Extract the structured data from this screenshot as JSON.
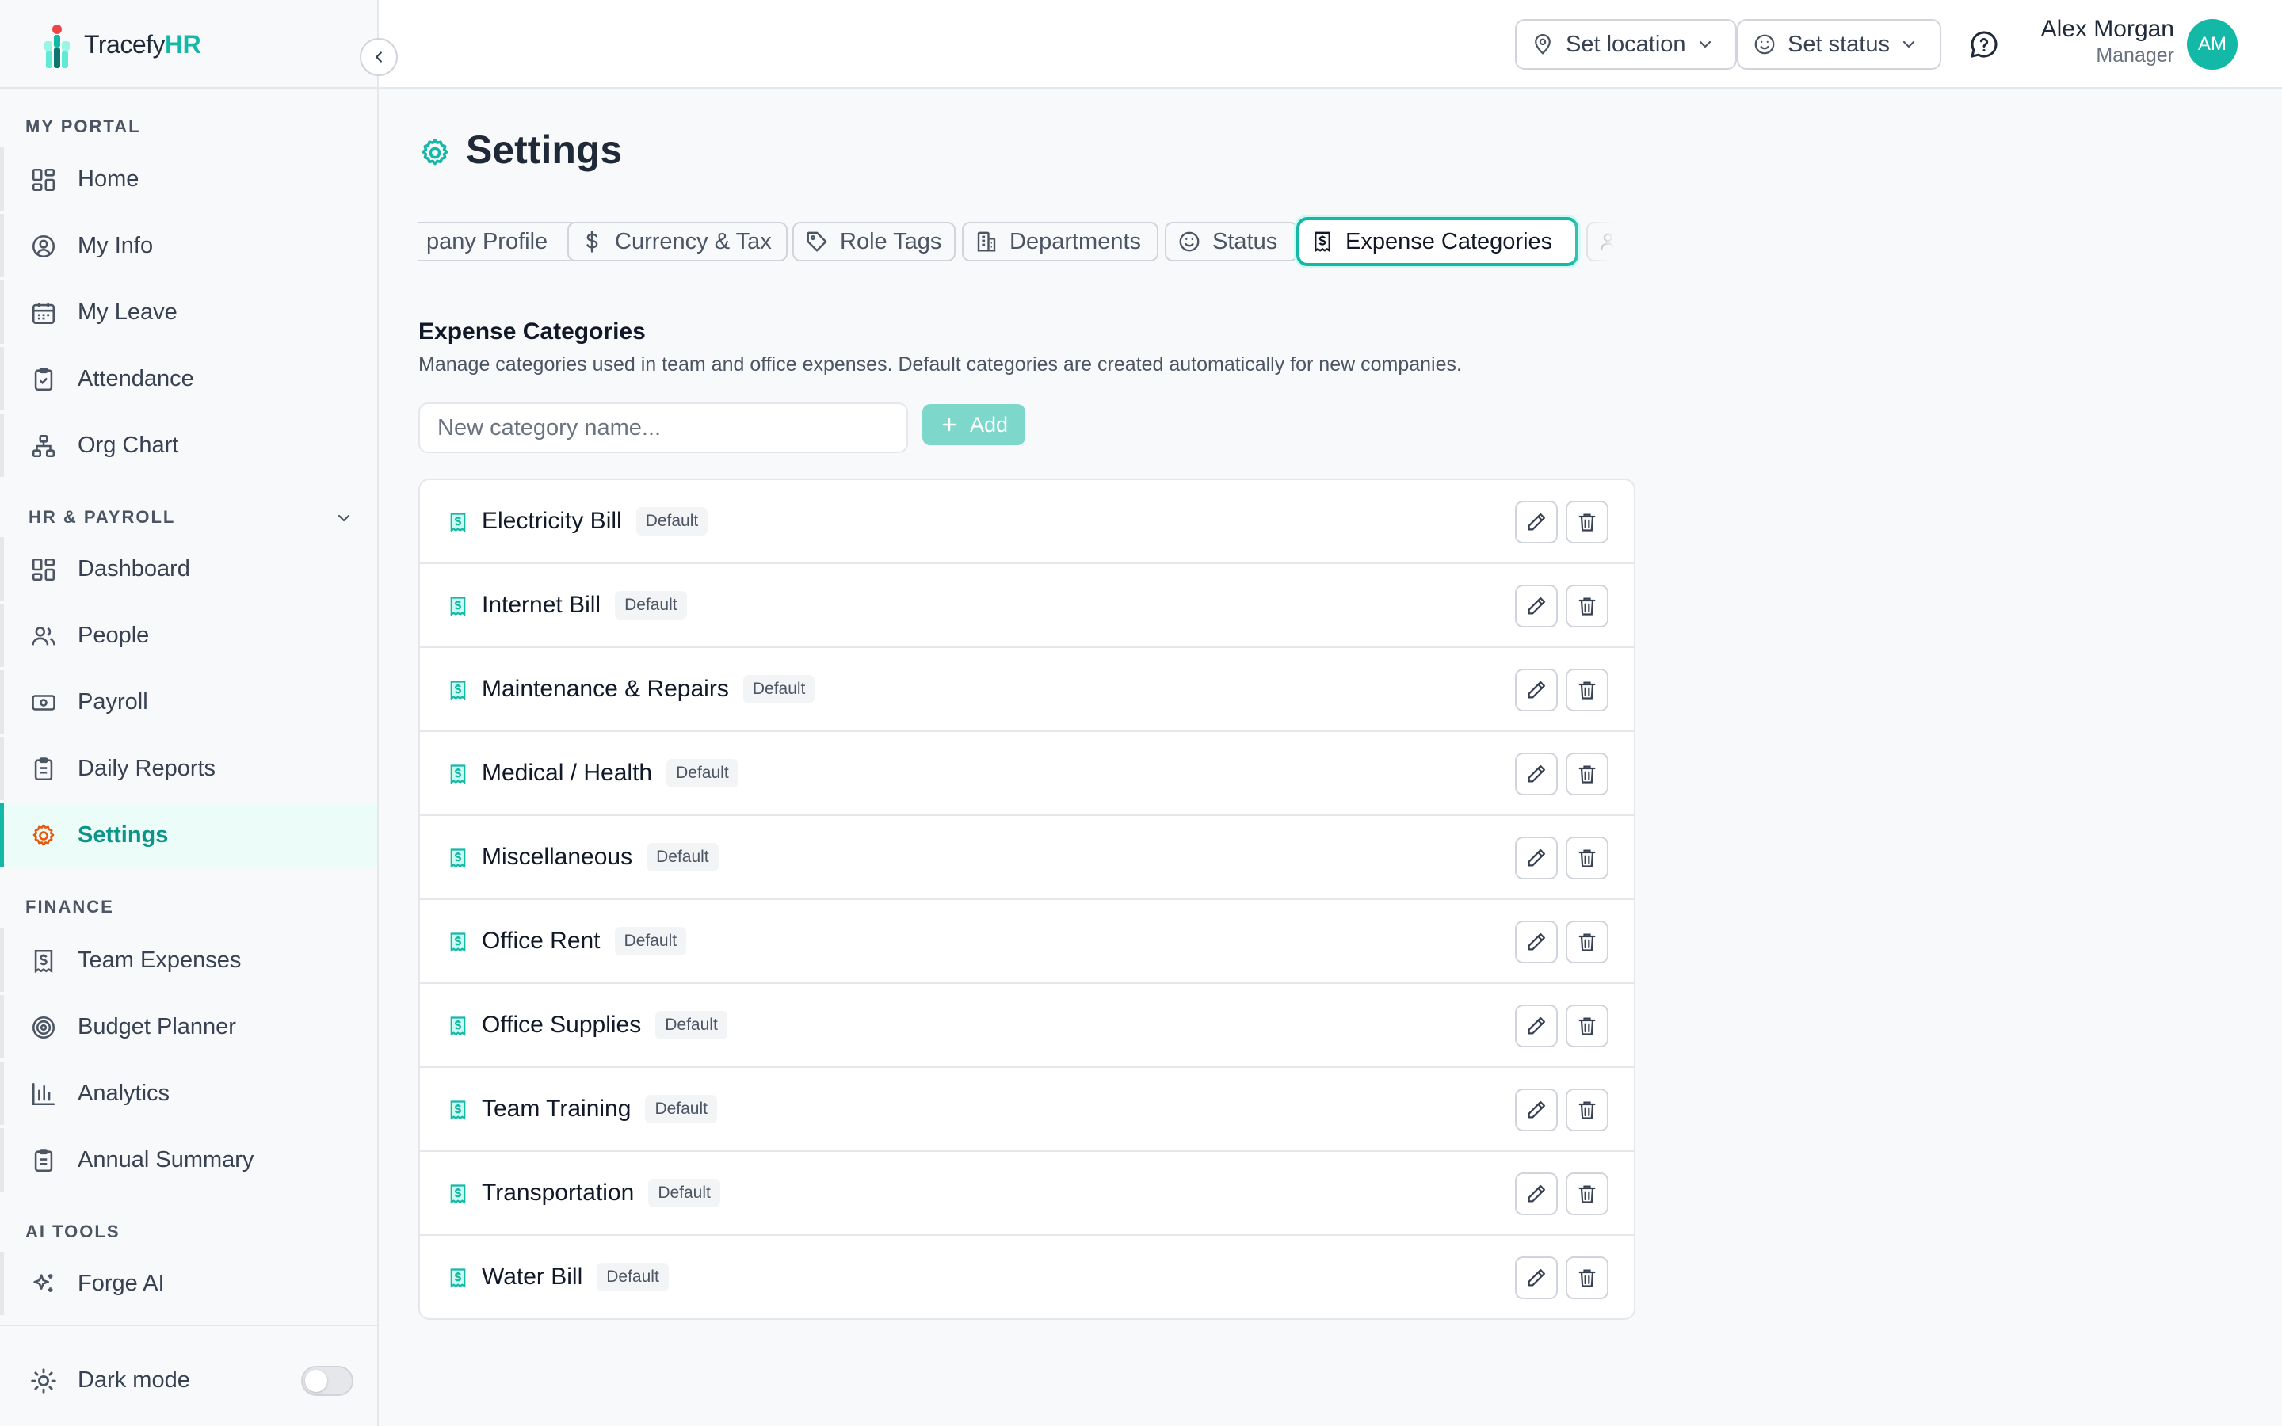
{
  "brand": {
    "name_plain": "Tracefy",
    "name_accent": "HR"
  },
  "sidebar": {
    "sections": [
      {
        "title": "MY PORTAL",
        "items": [
          {
            "label": "Home",
            "icon": "grid-icon"
          },
          {
            "label": "My Info",
            "icon": "user-circle-icon"
          },
          {
            "label": "My Leave",
            "icon": "calendar-icon"
          },
          {
            "label": "Attendance",
            "icon": "clipboard-check-icon"
          },
          {
            "label": "Org Chart",
            "icon": "org-chart-icon"
          }
        ]
      },
      {
        "title": "HR & PAYROLL",
        "items": [
          {
            "label": "Dashboard",
            "icon": "grid-icon"
          },
          {
            "label": "People",
            "icon": "users-icon"
          },
          {
            "label": "Payroll",
            "icon": "banknote-icon"
          },
          {
            "label": "Daily Reports",
            "icon": "clipboard-icon"
          },
          {
            "label": "Settings",
            "icon": "gear-icon",
            "active": true
          }
        ]
      },
      {
        "title": "FINANCE",
        "items": [
          {
            "label": "Team Expenses",
            "icon": "receipt-icon"
          },
          {
            "label": "Budget Planner",
            "icon": "target-icon"
          },
          {
            "label": "Analytics",
            "icon": "bar-chart-icon"
          },
          {
            "label": "Annual Summary",
            "icon": "clipboard-icon"
          }
        ]
      },
      {
        "title": "AI TOOLS",
        "items": [
          {
            "label": "Forge AI",
            "icon": "sparkles-icon"
          }
        ]
      }
    ],
    "dark_mode": {
      "label": "Dark mode",
      "enabled": false
    }
  },
  "topbar": {
    "location_label": "Set location",
    "status_label": "Set status",
    "user": {
      "name": "Alex Morgan",
      "role": "Manager",
      "initials": "AM"
    }
  },
  "page": {
    "title": "Settings"
  },
  "tabs": [
    {
      "label": "pany Profile",
      "icon": ""
    },
    {
      "label": "Currency & Tax",
      "icon": "dollar-icon"
    },
    {
      "label": "Role Tags",
      "icon": "tag-icon"
    },
    {
      "label": "Departments",
      "icon": "building-icon"
    },
    {
      "label": "Status",
      "icon": "smile-icon"
    },
    {
      "label": "Expense Categories",
      "icon": "receipt-icon",
      "active": true
    },
    {
      "label": "",
      "icon": "users-icon"
    }
  ],
  "expense_categories": {
    "heading": "Expense Categories",
    "description": "Manage categories used in team and office expenses. Default categories are created automatically for new companies.",
    "input_placeholder": "New category name...",
    "add_label": "Add",
    "items": [
      {
        "name": "Electricity Bill",
        "badge": "Default"
      },
      {
        "name": "Internet Bill",
        "badge": "Default"
      },
      {
        "name": "Maintenance & Repairs",
        "badge": "Default"
      },
      {
        "name": "Medical / Health",
        "badge": "Default"
      },
      {
        "name": "Miscellaneous",
        "badge": "Default"
      },
      {
        "name": "Office Rent",
        "badge": "Default"
      },
      {
        "name": "Office Supplies",
        "badge": "Default"
      },
      {
        "name": "Team Training",
        "badge": "Default"
      },
      {
        "name": "Transportation",
        "badge": "Default"
      },
      {
        "name": "Water Bill",
        "badge": "Default"
      }
    ]
  },
  "colors": {
    "accent": "#14b8a6",
    "accent_light": "#ecfdf9",
    "settings_icon_active": "#ea580c"
  }
}
